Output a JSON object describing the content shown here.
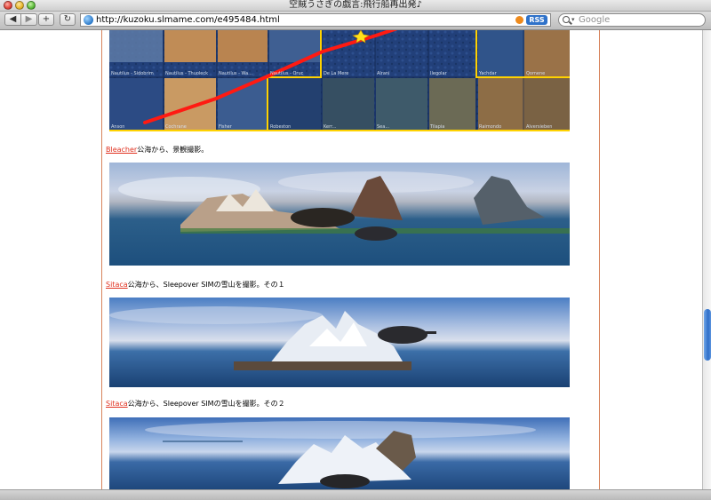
{
  "window": {
    "title": "空賊うさぎの戯言:飛行船再出発♪"
  },
  "toolbar": {
    "back_glyph": "◀",
    "forward_glyph": "▶",
    "add_glyph": "+",
    "reload_glyph": "↻",
    "url": "http://kuzoku.slmame.com/e495484.html",
    "rss_label": "RSS",
    "search_placeholder": "Google",
    "search_caret": "▾"
  },
  "map": {
    "tile_labels_row1": [
      "Nautilus - Sidobrim",
      "Nautilus - Thuoleck",
      "Nautilus - Wa...",
      "Nautilus - Oruc",
      "De La Mere",
      "Alrani",
      "Ilegolar",
      "Yachdar",
      "Qomene"
    ],
    "tile_labels_row2": [
      "Anson",
      "Cochrane",
      "Fisher",
      "Robeston",
      "Kerr...",
      "Sea...",
      "Tilapia",
      "Raimondo",
      "Alversieben"
    ],
    "route_color": "#ff1a12",
    "border_color": "#ffd200"
  },
  "captions": [
    {
      "link": "Bleacher",
      "text": "公海から、景観撮影。"
    },
    {
      "link": "Sitaca",
      "text": "公海から、Sleepover SIMの雪山を撮影。その１"
    },
    {
      "link": "Sitaca",
      "text": "公海から、Sleepover SIMの雪山を撮影。その２"
    }
  ],
  "colors": {
    "link": "#e0301e",
    "page_border": "#d7845c",
    "scroll_thumb": "#2f6fc8"
  }
}
